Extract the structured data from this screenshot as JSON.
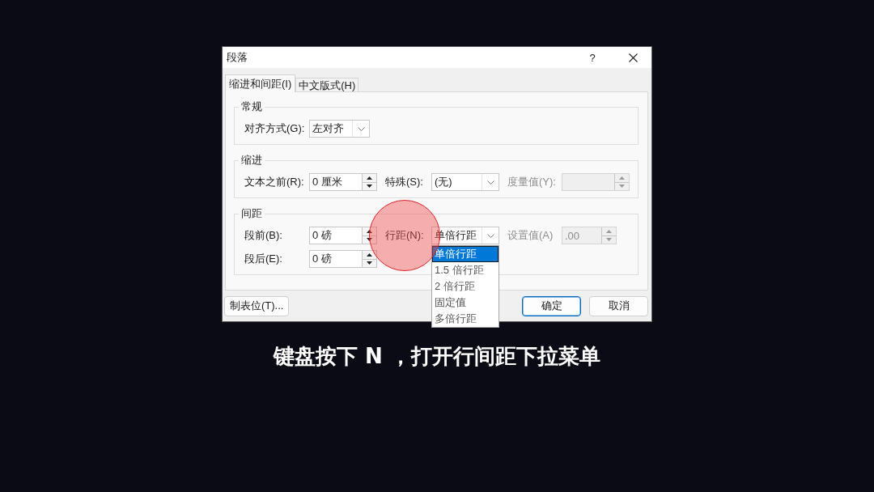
{
  "dialog": {
    "title": "段落",
    "help": "?"
  },
  "tabs": [
    {
      "label": "缩进和间距(I)",
      "selected": true
    },
    {
      "label": "中文版式(H)",
      "selected": false
    }
  ],
  "groups": [
    {
      "title": "常规",
      "rows": [
        [
          {
            "kind": "label",
            "text": "对齐方式(G):",
            "disabled": false
          },
          {
            "kind": "combo",
            "value": "左对齐",
            "expanded": false
          }
        ]
      ]
    },
    {
      "title": "缩进",
      "rows": [
        [
          {
            "kind": "label",
            "text": "文本之前(R):",
            "disabled": false
          },
          {
            "kind": "spin",
            "value": "0 厘米",
            "disabled": false
          },
          {
            "kind": "label",
            "text": "特殊(S):",
            "disabled": false
          },
          {
            "kind": "combo",
            "value": "(无)",
            "expanded": false
          },
          {
            "kind": "label",
            "text": "度量值(Y):",
            "disabled": true
          },
          {
            "kind": "spin",
            "disabled": true
          }
        ]
      ]
    },
    {
      "title": "间距",
      "rows": [
        [
          {
            "kind": "label",
            "text": "段前(B):",
            "disabled": false
          },
          {
            "kind": "spin",
            "value": "0 磅",
            "disabled": false
          },
          {
            "kind": "label",
            "text": "行距(N):",
            "disabled": false
          },
          {
            "kind": "combo",
            "value": "单倍行距",
            "expanded": true,
            "options": [
              {
                "label": "单倍行距",
                "selected": true
              },
              {
                "label": "1.5 倍行距",
                "selected": false
              },
              {
                "label": "2 倍行距",
                "selected": false
              },
              {
                "label": "固定值",
                "selected": false
              },
              {
                "label": "多倍行距",
                "selected": false
              }
            ]
          },
          {
            "kind": "label",
            "text": "设置值(A)",
            "disabled": true
          },
          {
            "kind": "spin",
            "value": ".00",
            "disabled": true
          }
        ],
        [
          {
            "kind": "label",
            "text": "段后(E):",
            "disabled": false
          },
          {
            "kind": "spin",
            "value": "0 磅",
            "disabled": false
          }
        ]
      ]
    }
  ],
  "footer": {
    "left": [
      {
        "label": "制表位(T)...",
        "default": false
      }
    ],
    "right": [
      {
        "label": "确定",
        "default": true
      },
      {
        "label": "取消",
        "default": false
      }
    ]
  },
  "caption": "键盘按下 N ，打开行间距下拉菜单"
}
